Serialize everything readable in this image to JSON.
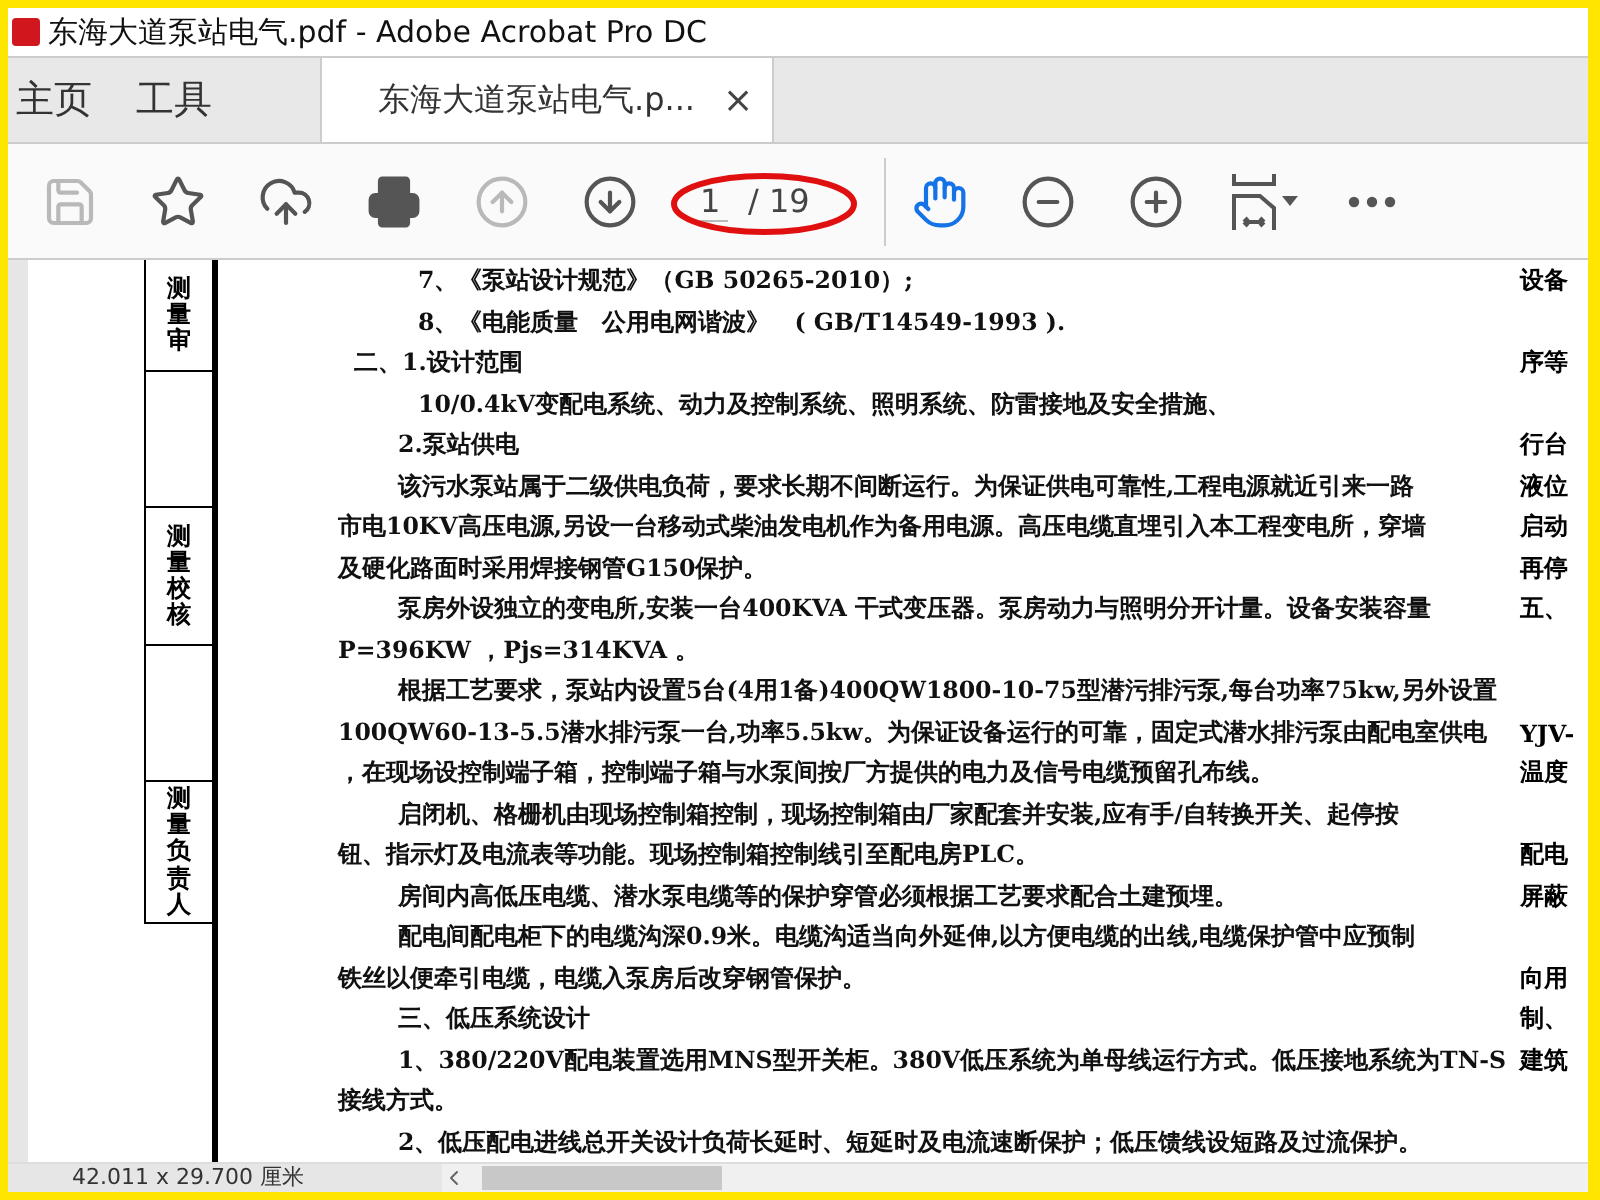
{
  "window": {
    "title": "东海大道泵站电气.pdf - Adobe Acrobat Pro DC"
  },
  "tabs": [
    {
      "label": "主页",
      "kind": "nav",
      "selected": false
    },
    {
      "label": "工具",
      "kind": "nav",
      "selected": false
    },
    {
      "label": "东海大道泵站电气.p...",
      "kind": "document",
      "selected": true
    }
  ],
  "tab_close": "×",
  "toolbar": {
    "left": [
      {
        "kind": "save",
        "disabled": true,
        "selected": false
      },
      {
        "kind": "bookmark",
        "disabled": false,
        "selected": false
      },
      {
        "kind": "upload",
        "disabled": false,
        "selected": false
      },
      {
        "kind": "print",
        "disabled": false,
        "selected": false
      },
      {
        "kind": "prev",
        "disabled": true,
        "selected": false
      },
      {
        "kind": "next",
        "disabled": false,
        "selected": false
      }
    ],
    "page": {
      "value": "1",
      "total": "/ 19",
      "circled": true
    },
    "right": [
      {
        "kind": "hand",
        "disabled": false,
        "selected": true
      },
      {
        "kind": "zoom_out",
        "disabled": false,
        "selected": false
      },
      {
        "kind": "zoom_in",
        "disabled": false,
        "selected": false
      },
      {
        "kind": "fit",
        "disabled": false,
        "selected": false
      },
      {
        "kind": "more",
        "disabled": false,
        "selected": false
      }
    ]
  },
  "document": {
    "side_labels": [
      {
        "text": "测量审",
        "kind": "label"
      },
      {
        "kind": "blank"
      },
      {
        "text": "测量校核",
        "kind": "label"
      },
      {
        "kind": "blank"
      },
      {
        "text": "测量负责人",
        "kind": "label"
      }
    ],
    "lines": [
      {
        "text": "7、《泵站设计规范》（GB 50265-2010）;",
        "kind": "list",
        "margin": "设备"
      },
      {
        "text": "8、《电能质量　公用电网谐波》　( GB/T14549-1993 ).",
        "kind": "list"
      },
      {
        "text": "二、1.设计范围",
        "kind": "heading",
        "margin": "序等"
      },
      {
        "text": "10/0.4kV变配电系统、动力及控制系统、照明系统、防雷接地及安全措施、",
        "kind": "list"
      },
      {
        "text": "2.泵站供电",
        "kind": "para",
        "margin": "行台"
      },
      {
        "text": "该污水泵站属于二级供电负荷，要求长期不间断运行。为保证供电可靠性,工程电源就近引来一路",
        "kind": "para",
        "margin": "液位"
      },
      {
        "text": "市电10KV高压电源,另设一台移动式柴油发电机作为备用电源。高压电缆直埋引入本工程变电所，穿墙",
        "kind": "cont",
        "margin": "启动"
      },
      {
        "text": "及硬化路面时采用焊接钢管G150保护。",
        "kind": "cont",
        "margin": "再停"
      },
      {
        "text": "泵房外设独立的变电所,安装一台400KVA 干式变压器。泵房动力与照明分开计量。设备安装容量",
        "kind": "para",
        "margin": "五、"
      },
      {
        "text": "P=396KW ，Pjs=314KVA 。",
        "kind": "cont"
      },
      {
        "text": "根据工艺要求，泵站内设置5台(4用1备)400QW1800-10-75型潜污排污泵,每台功率75kw,另外设置",
        "kind": "para"
      },
      {
        "text": "100QW60-13-5.5潜水排污泵一台,功率5.5kw。为保证设备运行的可靠，固定式潜水排污泵由配电室供电",
        "kind": "cont",
        "margin": "YJV-"
      },
      {
        "text": "，在现场设控制端子箱，控制端子箱与水泵间按厂方提供的电力及信号电缆预留孔布线。",
        "kind": "cont",
        "margin": "温度"
      },
      {
        "text": "启闭机、格栅机由现场控制箱控制，现场控制箱由厂家配套并安装,应有手/自转换开关、起停按",
        "kind": "para"
      },
      {
        "text": "钮、指示灯及电流表等功能。现场控制箱控制线引至配电房PLC。",
        "kind": "cont",
        "margin": "配电"
      },
      {
        "text": "房间内高低压电缆、潜水泵电缆等的保护穿管必须根据工艺要求配合土建预埋。",
        "kind": "para",
        "margin": "屏蔽"
      },
      {
        "text": "配电间配电柜下的电缆沟深0.9米。电缆沟适当向外延伸,以方便电缆的出线,电缆保护管中应预制",
        "kind": "para"
      },
      {
        "text": "铁丝以便牵引电缆，电缆入泵房后改穿钢管保护。",
        "kind": "cont",
        "margin": "向用"
      },
      {
        "text": "三、低压系统设计",
        "kind": "para",
        "margin": "制、"
      },
      {
        "text": "1、380/220V配电装置选用MNS型开关柜。380V低压系统为单母线运行方式。低压接地系统为TN-S",
        "kind": "para",
        "margin": "建筑"
      },
      {
        "text": "接线方式。",
        "kind": "cont"
      },
      {
        "text": "2、低压配电进线总开关设计负荷长延时、短延时及电流速断保护；低压馈线设短路及过流保护。",
        "kind": "para"
      }
    ]
  },
  "status_bar": {
    "page_size": "42.011 x 29.700 厘米"
  }
}
